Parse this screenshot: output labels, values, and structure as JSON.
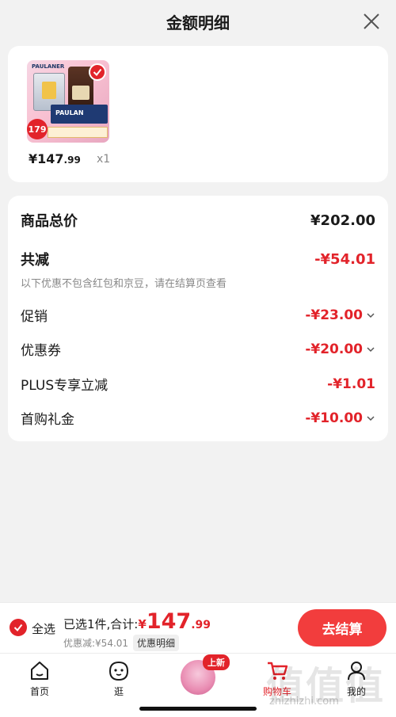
{
  "header": {
    "title": "金额明细",
    "close_icon": "close-icon"
  },
  "product": {
    "image_brand_text": "PAULANER",
    "image_box_text": "PAULAN",
    "image_price_badge": "179",
    "price_int": "¥147",
    "price_dec": ".99",
    "quantity": "x1"
  },
  "breakdown": {
    "total_label": "商品总价",
    "total_value": "¥202.00",
    "reduction_label": "共减",
    "reduction_value": "-¥54.01",
    "note": "以下优惠不包含红包和京豆，请在结算页查看",
    "items": [
      {
        "label": "促销",
        "value": "-¥23.00",
        "expandable": true
      },
      {
        "label": "优惠券",
        "value": "-¥20.00",
        "expandable": true
      },
      {
        "label": "PLUS专享立减",
        "value": "-¥1.01",
        "expandable": false
      },
      {
        "label": "首购礼金",
        "value": "-¥10.00",
        "expandable": true
      }
    ]
  },
  "bottom_bar": {
    "select_all_label": "全选",
    "total_prefix": "已选1件,合计:",
    "total_yen": "¥",
    "total_int": "147",
    "total_dec": ".99",
    "discount_text": "优惠减:¥54.01",
    "detail_button": "优惠明细",
    "checkout_button": "去结算"
  },
  "tabs": [
    {
      "label": "首页",
      "icon": "home-icon",
      "active": false
    },
    {
      "label": "逛",
      "icon": "browse-face-icon",
      "active": false
    },
    {
      "label": "",
      "icon": "promo-thumbnail",
      "badge": "上新",
      "active": false
    },
    {
      "label": "购物车",
      "icon": "cart-icon",
      "active": true
    },
    {
      "label": "我的",
      "icon": "profile-icon",
      "active": false
    }
  ],
  "watermark": {
    "text": "值值值",
    "url": "zhizhizhi.com"
  },
  "colors": {
    "accent": "#e2232a",
    "checkout": "#f23d3d",
    "background": "#f2f2f2"
  }
}
